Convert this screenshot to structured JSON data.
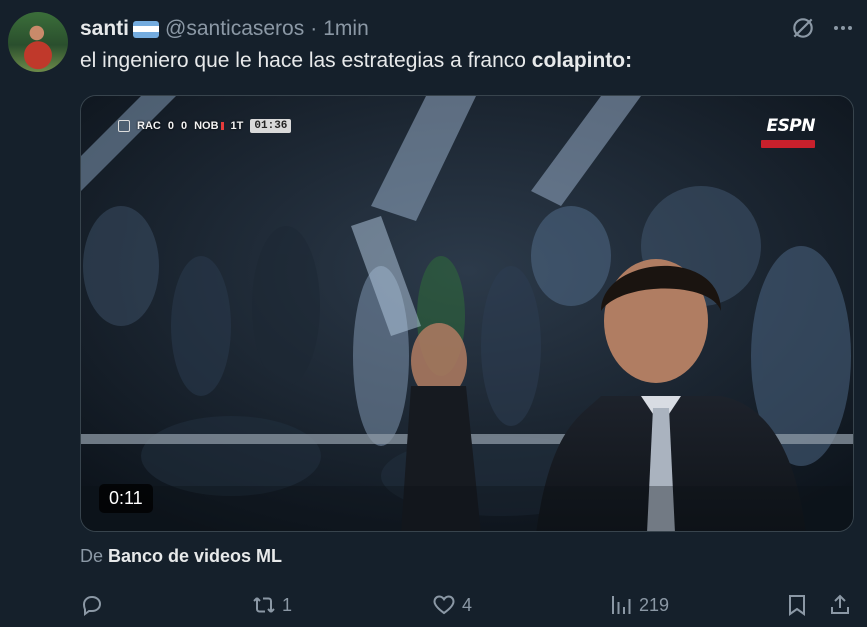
{
  "author": {
    "display_name": "santi",
    "handle": "@santicaseros",
    "separator": "·",
    "time": "1min",
    "flag_colors": [
      "#74acdf",
      "#ffffff",
      "#74acdf"
    ]
  },
  "tweet": {
    "text_plain": "el ingeniero que le hace las estrategias a franco ",
    "text_bold": "colapinto:"
  },
  "video": {
    "duration": "0:11",
    "scorebug": {
      "home": "RAC",
      "home_score": "0",
      "away_score": "0",
      "away": "NOB",
      "period": "1T",
      "clock": "01:36"
    },
    "broadcaster": "ESPN"
  },
  "source": {
    "prefix": "De",
    "name": "Banco de videos ML"
  },
  "actions": {
    "reply_count": "",
    "retweet_count": "1",
    "like_count": "4",
    "view_count": "219"
  },
  "colors": {
    "background": "#15202b",
    "text_primary": "#e7e9ea",
    "text_secondary": "#8b98a5",
    "border": "#38444d"
  }
}
